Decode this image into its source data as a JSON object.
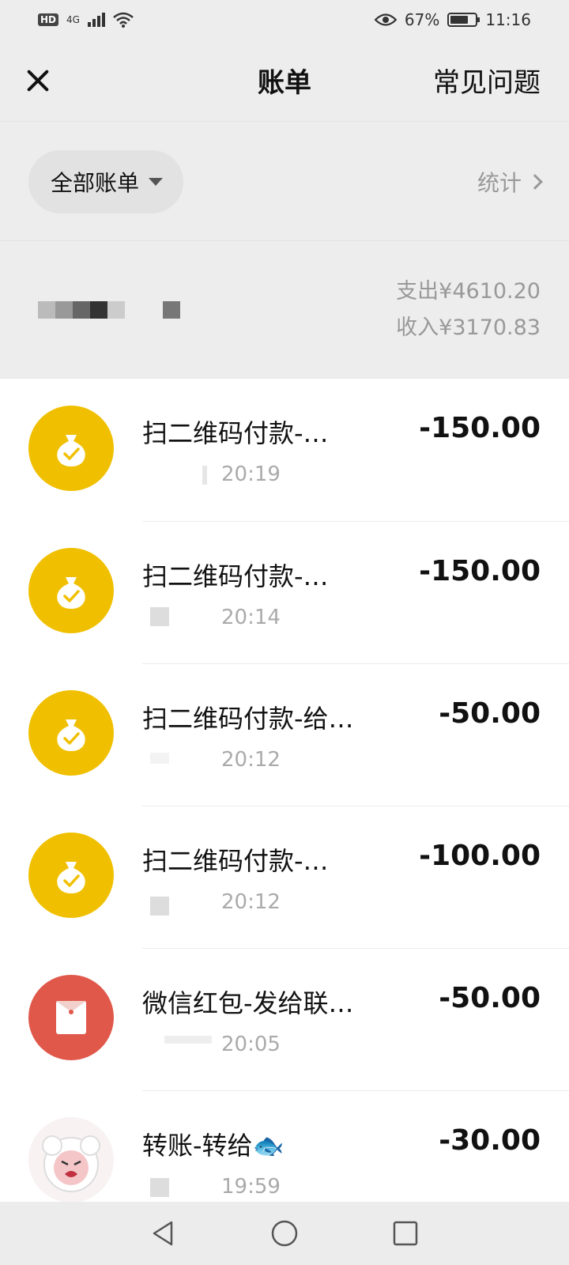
{
  "status_bar": {
    "hd": "HD",
    "network": "4G",
    "battery_percent": "67%",
    "time": "11:16"
  },
  "nav": {
    "title": "账单",
    "faq_label": "常见问题"
  },
  "filter": {
    "label": "全部账单",
    "stats_label": "统计"
  },
  "summary": {
    "expense": "支出¥4610.20",
    "income": "收入¥3170.83"
  },
  "bills": [
    {
      "title": "扫二维码付款-…",
      "time": "20:19",
      "amount": "-150.00",
      "icon": "qr-payment-icon"
    },
    {
      "title": "扫二维码付款-…",
      "time": "20:14",
      "amount": "-150.00",
      "icon": "qr-payment-icon"
    },
    {
      "title": "扫二维码付款-给…",
      "time": "20:12",
      "amount": "-50.00",
      "icon": "qr-payment-icon"
    },
    {
      "title": "扫二维码付款-…",
      "time": "20:12",
      "amount": "-100.00",
      "icon": "qr-payment-icon"
    },
    {
      "title": "微信红包-发给联…",
      "time": "20:05",
      "amount": "-50.00",
      "icon": "red-packet-icon"
    },
    {
      "title": "转账-转给🐟",
      "time": "19:59",
      "amount": "-30.00",
      "icon": "avatar-icon"
    }
  ],
  "colors": {
    "qr_icon": "#f0c000",
    "red_packet_icon": "#e0584a",
    "background": "#ededed"
  }
}
